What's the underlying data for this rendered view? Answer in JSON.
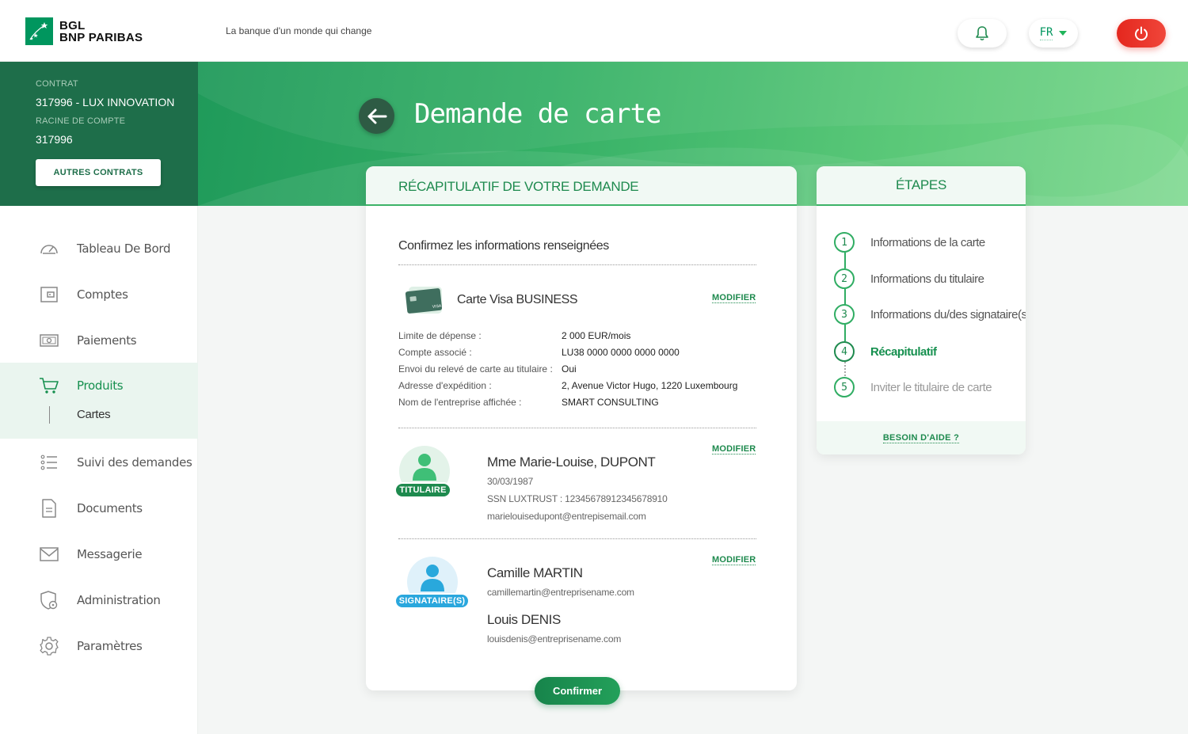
{
  "brand": {
    "line1": "BGL",
    "line2": "BNP PARIBAS",
    "tagline": "La banque d'un monde qui change"
  },
  "header": {
    "language": "FR"
  },
  "page": {
    "title": "Demande de carte"
  },
  "contract": {
    "contract_label": "CONTRAT",
    "contract_value": "317996 - LUX INNOVATION",
    "root_label": "RACINE DE COMPTE",
    "root_value": "317996",
    "other_contracts": "AUTRES CONTRATS"
  },
  "sidebar": {
    "items": [
      {
        "label": "Tableau De Bord",
        "icon": "dashboard-icon"
      },
      {
        "label": "Comptes",
        "icon": "wallet-icon"
      },
      {
        "label": "Paiements",
        "icon": "money-icon"
      },
      {
        "label": "Produits",
        "icon": "cart-icon",
        "active": true
      },
      {
        "label": "Suivi des demandes",
        "icon": "list-icon"
      },
      {
        "label": "Documents",
        "icon": "document-icon"
      },
      {
        "label": "Messagerie",
        "icon": "mail-icon"
      },
      {
        "label": "Administration",
        "icon": "admin-shield-icon"
      },
      {
        "label": "Paramètres",
        "icon": "gear-icon"
      }
    ],
    "sub_item": "Cartes"
  },
  "summary": {
    "header": "RÉCAPITULATIF DE VOTRE DEMANDE",
    "intro": "Confirmez les informations renseignées",
    "card_name": "Carte Visa BUSINESS",
    "modify": "MODIFIER",
    "details": [
      {
        "label": "Limite de dépense :",
        "value": "2 000 EUR/mois"
      },
      {
        "label": "Compte associé :",
        "value": "LU38 0000 0000 0000 0000"
      },
      {
        "label": "Envoi du relevé de carte au titulaire :",
        "value": "Oui"
      },
      {
        "label": "Adresse d'expédition :",
        "value": "2, Avenue Victor Hugo, 1220 Luxembourg"
      },
      {
        "label": "Nom de l'entreprise affichée :",
        "value": "SMART CONSULTING"
      }
    ],
    "holder": {
      "badge": "TITULAIRE",
      "name": "Mme Marie-Louise, DUPONT",
      "birth": "30/03/1987",
      "ssn": "SSN LUXTRUST : 12345678912345678910",
      "email": "marielouisedupont@entrepisemail.com"
    },
    "signatories": {
      "badge": "SIGNATAIRE(S)",
      "people": [
        {
          "name": "Camille MARTIN",
          "email": "camillemartin@entreprisename.com"
        },
        {
          "name": "Louis DENIS",
          "email": "louisdenis@entreprisename.com"
        }
      ]
    },
    "confirm": "Confirmer"
  },
  "steps": {
    "header": "ÉTAPES",
    "items": [
      {
        "num": "1",
        "label": "Informations de la carte"
      },
      {
        "num": "2",
        "label": "Informations du titulaire"
      },
      {
        "num": "3",
        "label": "Informations du/des signataire(s)"
      },
      {
        "num": "4",
        "label": "Récapitulatif",
        "state": "active"
      },
      {
        "num": "5",
        "label": "Inviter le titulaire de carte",
        "state": "upcoming"
      }
    ],
    "help": "BESOIN D'AIDE ?"
  },
  "colors": {
    "brand_green": "#00965e",
    "accent_green": "#1e8a4e",
    "power_red": "#e4271e"
  }
}
